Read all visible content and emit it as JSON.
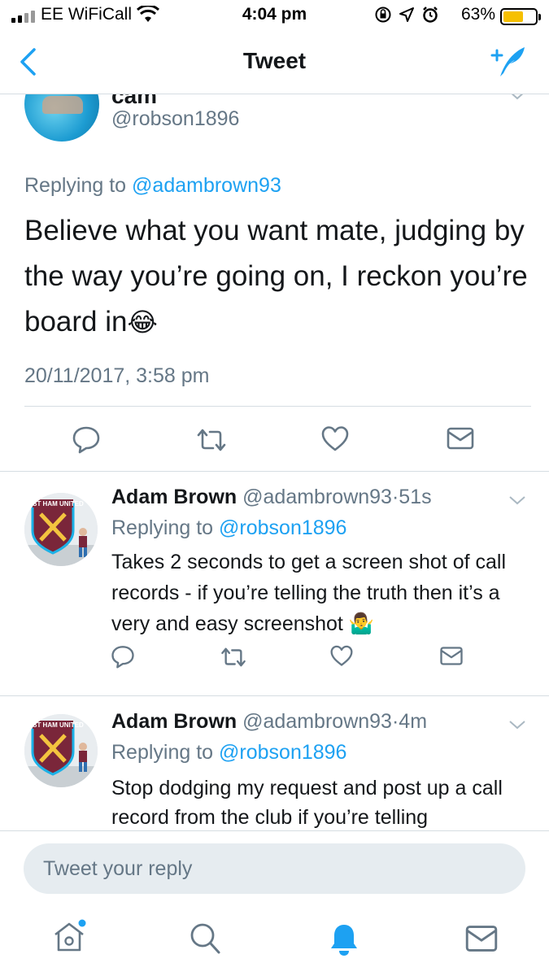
{
  "status_bar": {
    "carrier": "EE WiFiCall",
    "time": "4:04 pm",
    "battery": "63%",
    "battery_level": 0.63
  },
  "nav": {
    "title": "Tweet"
  },
  "main_tweet": {
    "name": "cam",
    "handle": "@robson1896",
    "replying_label": "Replying to",
    "replying_to": "@adambrown93",
    "text": "Believe what you want mate, judging by the way you’re going on, I reckon you’re board in",
    "emoji": "😂",
    "timestamp": "20/11/2017, 3:58 pm"
  },
  "replies": [
    {
      "name": "Adam Brown",
      "handle": "@adambrown93",
      "separator": "·",
      "time": "51s",
      "replying_label": "Replying to",
      "replying_to": "@robson1896",
      "text": "Takes 2 seconds to get a screen shot of call records - if you’re telling the truth then it’s a very and easy screenshot",
      "emoji": "🤷‍♂️",
      "avatar_text": "WEST HAM UNITED"
    },
    {
      "name": "Adam Brown",
      "handle": "@adambrown93",
      "separator": "·",
      "time": "4m",
      "replying_label": "Replying to",
      "replying_to": "@robson1896",
      "text": "Stop dodging my request and post up a call record from the club if you’re telling",
      "emoji": "",
      "avatar_text": "WEST HAM UNITED"
    }
  ],
  "reply_bar": {
    "placeholder": "Tweet your reply"
  },
  "icons": {
    "accent": "#1da1f2",
    "icon_gray": "#657786",
    "text_dark": "#14171a"
  }
}
